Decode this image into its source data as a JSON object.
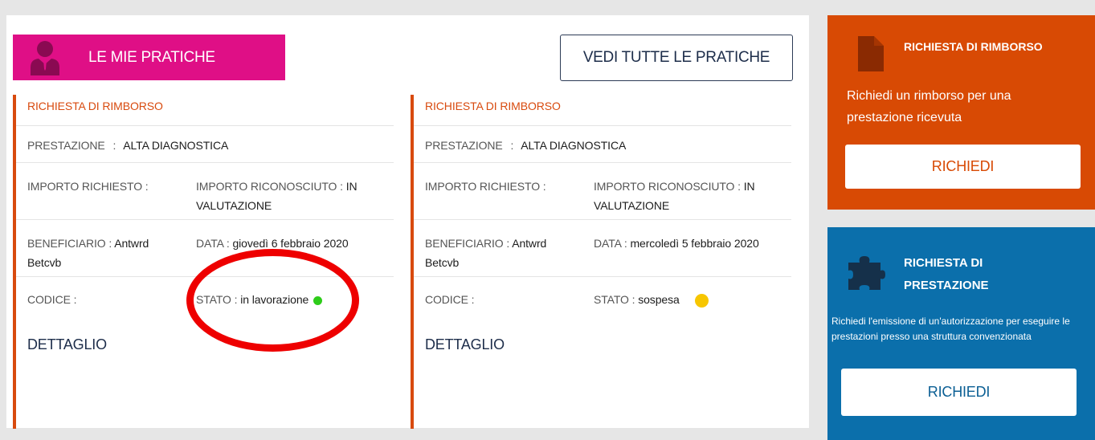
{
  "header": {
    "title": "LE MIE PRATICHE",
    "view_all_label": "VEDI TUTTE LE PRATICHE"
  },
  "labels": {
    "prestazione": "PRESTAZIONE",
    "importo_richiesto": "IMPORTO RICHIESTO :",
    "importo_riconosciuto": "IMPORTO RICONOSCIUTO :",
    "beneficiario": "BENEFICIARIO :",
    "data": "DATA :",
    "codice": "CODICE :",
    "stato": "STATO :",
    "separator": ":",
    "dettaglio": "DETTAGLIO"
  },
  "practices": [
    {
      "type": "RICHIESTA DI RIMBORSO",
      "prestazione": "ALTA DIAGNOSTICA",
      "importo_richiesto": "",
      "importo_riconosciuto": "IN VALUTAZIONE",
      "beneficiario": "Antwrd Betcvb",
      "data": "giovedì 6 febbraio 2020",
      "codice": "",
      "stato": "in lavorazione",
      "stato_color": "#2ecc1a"
    },
    {
      "type": "RICHIESTA DI RIMBORSO",
      "prestazione": "ALTA DIAGNOSTICA",
      "importo_richiesto": "",
      "importo_riconosciuto": "IN VALUTAZIONE",
      "beneficiario": "Antwrd Betcvb",
      "data": "mercoledì 5 febbraio 2020",
      "codice": "",
      "stato": "sospesa",
      "stato_color": "#f7c600"
    }
  ],
  "side_boxes": [
    {
      "title": "RICHIESTA DI RIMBORSO",
      "description": "Richiedi un rimborso per una prestazione ricevuta",
      "button_label": "RICHIEDI",
      "icon": "document-icon",
      "color": "#d84a04"
    },
    {
      "title": "RICHIESTA DI PRESTAZIONE",
      "description": "Richiedi l'emissione di un'autorizzazione per eseguire le prestazioni presso una struttura convenzionata",
      "button_label": "RICHIEDI",
      "icon": "puzzle-icon",
      "color": "#0b6fab"
    }
  ],
  "colors": {
    "accent_magenta": "#df0f86",
    "accent_orange": "#d84a04",
    "accent_blue": "#0b6fab",
    "annotation_red": "#ee0000"
  }
}
